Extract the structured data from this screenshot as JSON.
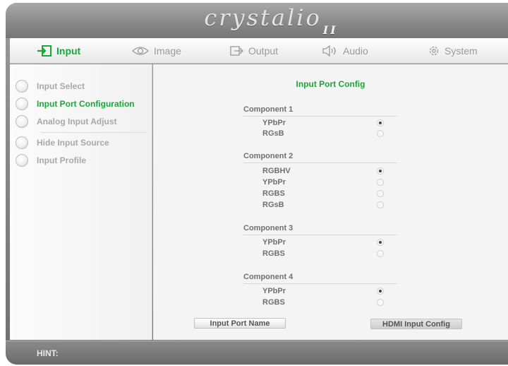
{
  "brand": {
    "logo_text": "crystalio",
    "logo_suffix": "II"
  },
  "tabs": [
    {
      "label": "Input",
      "icon": "input-arrow-icon",
      "active": true
    },
    {
      "label": "Image",
      "icon": "eye-icon",
      "active": false
    },
    {
      "label": "Output",
      "icon": "output-arrow-icon",
      "active": false
    },
    {
      "label": "Audio",
      "icon": "speaker-icon",
      "active": false
    },
    {
      "label": "System",
      "icon": "gear-icon",
      "active": false
    }
  ],
  "sidebar": {
    "items": [
      {
        "label": "Input Select",
        "active": false
      },
      {
        "label": "Input Port Configuration",
        "active": true
      },
      {
        "label": "Analog Input Adjust",
        "active": false
      },
      {
        "label": "Hide Input Source",
        "active": false
      },
      {
        "label": "Input Profile",
        "active": false
      }
    ]
  },
  "main": {
    "title": "Input Port Config",
    "groups": [
      {
        "title": "Component 1",
        "options": [
          {
            "label": "YPbPr",
            "selected": true
          },
          {
            "label": "RGsB",
            "selected": false
          }
        ]
      },
      {
        "title": "Component 2",
        "options": [
          {
            "label": "RGBHV",
            "selected": true
          },
          {
            "label": "YPbPr",
            "selected": false
          },
          {
            "label": "RGBS",
            "selected": false
          },
          {
            "label": "RGsB",
            "selected": false
          }
        ]
      },
      {
        "title": "Component 3",
        "options": [
          {
            "label": "YPbPr",
            "selected": true
          },
          {
            "label": "RGBS",
            "selected": false
          }
        ]
      },
      {
        "title": "Component 4",
        "options": [
          {
            "label": "YPbPr",
            "selected": true
          },
          {
            "label": "RGBS",
            "selected": false
          }
        ]
      }
    ],
    "buttons": {
      "port_name": "Input Port Name",
      "hdmi_config": "HDMI Input Config"
    }
  },
  "hint": {
    "label": "HINT:"
  },
  "colors": {
    "accent": "#18a838",
    "text_muted": "#a8a8a8",
    "text_body": "#707070"
  }
}
